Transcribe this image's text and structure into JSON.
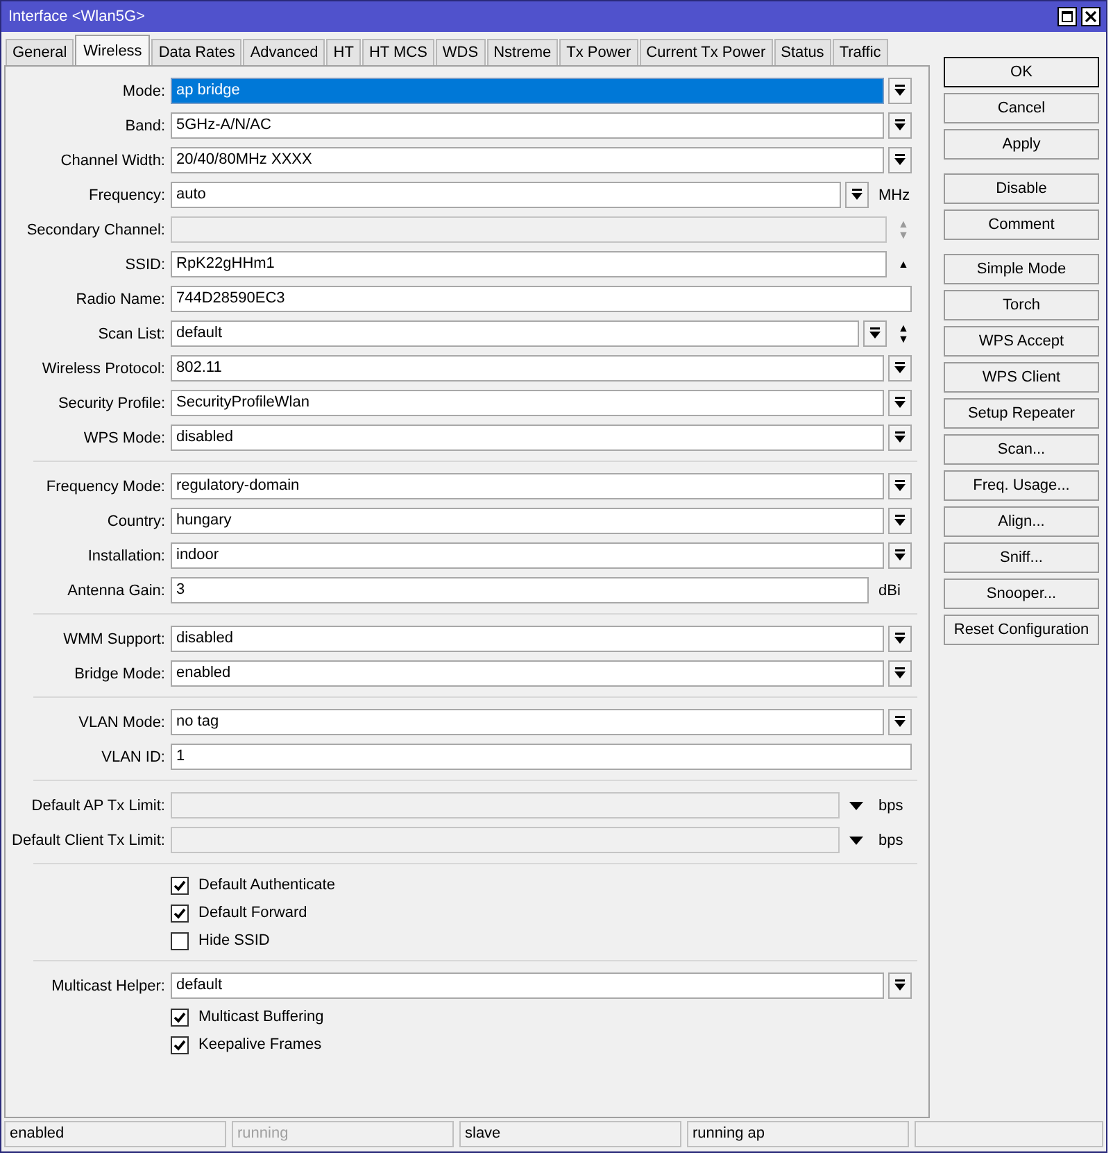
{
  "window": {
    "title": "Interface <Wlan5G>"
  },
  "tabs": [
    {
      "label": "General",
      "selected": false
    },
    {
      "label": "Wireless",
      "selected": true
    },
    {
      "label": "Data Rates",
      "selected": false
    },
    {
      "label": "Advanced",
      "selected": false
    },
    {
      "label": "HT",
      "selected": false
    },
    {
      "label": "HT MCS",
      "selected": false
    },
    {
      "label": "WDS",
      "selected": false
    },
    {
      "label": "Nstreme",
      "selected": false
    },
    {
      "label": "Tx Power",
      "selected": false
    },
    {
      "label": "Current Tx Power",
      "selected": false
    },
    {
      "label": "Status",
      "selected": false
    },
    {
      "label": "Traffic",
      "selected": false
    }
  ],
  "groups": [
    {
      "rows": [
        {
          "kind": "dropdown",
          "label": "Mode:",
          "value": "ap bridge",
          "highlighted": true
        },
        {
          "kind": "dropdown",
          "label": "Band:",
          "value": "5GHz-A/N/AC"
        },
        {
          "kind": "dropdown",
          "label": "Channel Width:",
          "value": "20/40/80MHz XXXX"
        },
        {
          "kind": "dropdown",
          "label": "Frequency:",
          "value": "auto",
          "unit": "MHz"
        },
        {
          "kind": "text",
          "label": "Secondary Channel:",
          "disabled": true,
          "arrows": "▲▼"
        },
        {
          "kind": "text",
          "label": "SSID:",
          "value": "RpK22gHHm1",
          "arrows": "▲"
        },
        {
          "kind": "text",
          "label": "Radio Name:",
          "value": "744D28590EC3"
        },
        {
          "kind": "dropdown",
          "label": "Scan List:",
          "value": "default",
          "arrows": "▲▼"
        },
        {
          "kind": "dropdown",
          "label": "Wireless Protocol:",
          "value": "802.11"
        },
        {
          "kind": "dropdown",
          "label": "Security Profile:",
          "value": "SecurityProfileWlan"
        },
        {
          "kind": "dropdown",
          "label": "WPS Mode:",
          "value": "disabled"
        }
      ]
    },
    {
      "rows": [
        {
          "kind": "dropdown",
          "label": "Frequency Mode:",
          "value": "regulatory-domain"
        },
        {
          "kind": "dropdown",
          "label": "Country:",
          "value": "hungary"
        },
        {
          "kind": "dropdown",
          "label": "Installation:",
          "value": "indoor"
        },
        {
          "kind": "text",
          "label": "Antenna Gain:",
          "value": "3",
          "unit": "dBi"
        }
      ]
    },
    {
      "rows": [
        {
          "kind": "dropdown",
          "label": "WMM Support:",
          "value": "disabled"
        },
        {
          "kind": "dropdown",
          "label": "Bridge Mode:",
          "value": "enabled"
        }
      ]
    },
    {
      "rows": [
        {
          "kind": "dropdown",
          "label": "VLAN Mode:",
          "value": "no tag"
        },
        {
          "kind": "text",
          "label": "VLAN ID:",
          "value": "1"
        }
      ]
    },
    {
      "rows": [
        {
          "kind": "combo",
          "label": "Default AP Tx Limit:",
          "disabled": true,
          "unit": "bps"
        },
        {
          "kind": "combo",
          "label": "Default Client Tx Limit:",
          "disabled": true,
          "unit": "bps"
        }
      ]
    },
    {
      "rows": [
        {
          "kind": "checkbox",
          "label": "Default Authenticate",
          "checked": true
        },
        {
          "kind": "checkbox",
          "label": "Default Forward",
          "checked": true
        },
        {
          "kind": "checkbox",
          "label": "Hide SSID",
          "checked": false
        }
      ]
    },
    {
      "rows": [
        {
          "kind": "dropdown",
          "label": "Multicast Helper:",
          "value": "default"
        },
        {
          "kind": "checkbox",
          "label": "Multicast Buffering",
          "checked": true
        },
        {
          "kind": "checkbox",
          "label": "Keepalive Frames",
          "checked": true
        }
      ]
    }
  ],
  "button_groups": [
    [
      {
        "label": "OK",
        "default": true
      },
      {
        "label": "Cancel",
        "default": false
      },
      {
        "label": "Apply",
        "default": false
      }
    ],
    [
      {
        "label": "Disable",
        "default": false
      },
      {
        "label": "Comment",
        "default": false
      }
    ],
    [
      {
        "label": "Simple Mode",
        "default": false
      },
      {
        "label": "Torch",
        "default": false
      },
      {
        "label": "WPS Accept",
        "default": false
      },
      {
        "label": "WPS Client",
        "default": false
      },
      {
        "label": "Setup Repeater",
        "default": false
      },
      {
        "label": "Scan...",
        "default": false
      },
      {
        "label": "Freq. Usage...",
        "default": false
      },
      {
        "label": "Align...",
        "default": false
      },
      {
        "label": "Sniff...",
        "default": false
      },
      {
        "label": "Snooper...",
        "default": false
      },
      {
        "label": "Reset Configuration",
        "default": false
      }
    ]
  ],
  "status_bar": [
    {
      "text": "enabled",
      "disabled": false
    },
    {
      "text": "running",
      "disabled": true
    },
    {
      "text": "slave",
      "disabled": false
    },
    {
      "text": "running ap",
      "disabled": false
    }
  ]
}
